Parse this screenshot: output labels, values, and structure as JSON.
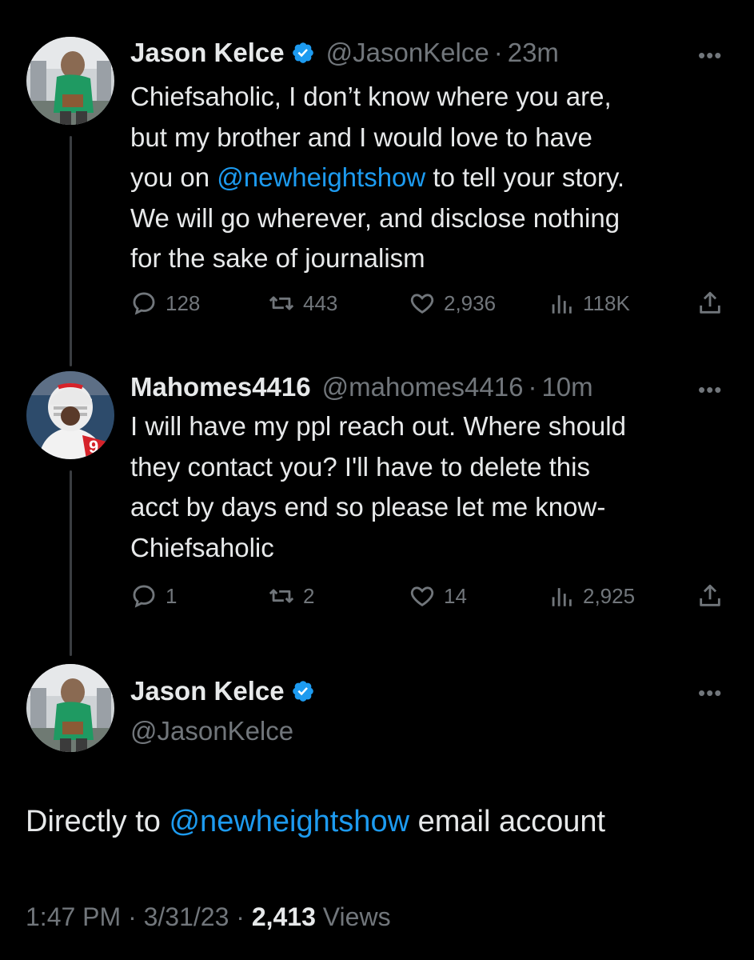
{
  "tweet1": {
    "name": "Jason Kelce",
    "handle": "@JasonKelce",
    "time": "23m",
    "text_1": "Chiefsaholic, I don’t know where you are,",
    "text_2": "but my brother and I would love to have",
    "text_3a": "you on ",
    "text_3_link": "@newheightshow",
    "text_3b": " to tell your story.",
    "text_4": "We will go wherever, and disclose nothing",
    "text_5": "for the sake of journalism",
    "replies": "128",
    "retweets": "443",
    "likes": "2,936",
    "views": "118K"
  },
  "tweet2": {
    "name": "Mahomes4416",
    "handle": "@mahomes4416",
    "time": "10m",
    "text_1": "I will have my ppl reach out.  Where should",
    "text_2": "they contact you?  I'll have to delete this",
    "text_3": "acct by days end so please let me know-",
    "text_4": "Chiefsaholic",
    "replies": "1",
    "retweets": "2",
    "likes": "14",
    "views": "2,925"
  },
  "main_tweet": {
    "name": "Jason Kelce",
    "handle": "@JasonKelce",
    "text_a": "Directly to ",
    "text_link": "@newheightshow",
    "text_b": " email account",
    "time": "1:47 PM",
    "date": "3/31/23",
    "views_count": "2,413",
    "views_label": "Views"
  },
  "separator": "·",
  "more_label": "•••",
  "icons": [
    "verified-badge-icon",
    "reply-icon",
    "retweet-icon",
    "like-icon",
    "views-icon",
    "share-icon",
    "more-icon"
  ],
  "colors": {
    "background": "#000000",
    "link": "#1d9bf0",
    "muted": "#71767b",
    "text": "#e7e9ea",
    "verified": "#1d9bf0"
  }
}
